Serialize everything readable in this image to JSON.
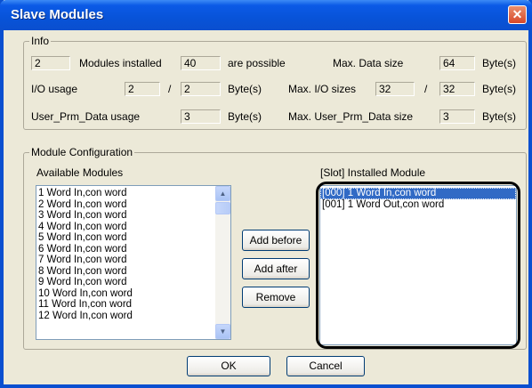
{
  "window": {
    "title": "Slave Modules",
    "close_glyph": "✕"
  },
  "info": {
    "legend": "Info",
    "modules_installed_value": "2",
    "modules_installed_label": "Modules installed",
    "modules_possible_value": "40",
    "modules_possible_label": "are possible",
    "max_data_size_label": "Max. Data size",
    "max_data_size_value": "64",
    "max_data_size_unit": "Byte(s)",
    "io_usage_label": "I/O usage",
    "io_usage_in": "2",
    "io_usage_sep": "/",
    "io_usage_out": "2",
    "io_usage_unit": "Byte(s)",
    "max_io_sizes_label": "Max. I/O sizes",
    "max_io_in": "32",
    "max_io_sep": "/",
    "max_io_out": "32",
    "max_io_unit": "Byte(s)",
    "user_prm_label": "User_Prm_Data usage",
    "user_prm_value": "3",
    "user_prm_unit": "Byte(s)",
    "max_user_prm_label": "Max. User_Prm_Data size",
    "max_user_prm_value": "3",
    "max_user_prm_unit": "Byte(s)"
  },
  "module_config": {
    "legend": "Module Configuration",
    "available_label": "Available Modules",
    "installed_label": "[Slot] Installed Module",
    "available_modules": [
      "1 Word In,con word",
      "2 Word In,con word",
      "3 Word In,con word",
      "4 Word In,con word",
      "5 Word In,con word",
      "6 Word In,con word",
      "7 Word In,con word",
      "8 Word In,con word",
      "9 Word In,con word",
      "10 Word In,con word",
      "11 Word In,con word",
      "12 Word In,con word"
    ],
    "installed_modules": [
      "[000] 1 Word In,con word",
      "[001] 1 Word Out,con word"
    ],
    "selected_installed_index": 0,
    "add_before": "Add before",
    "add_after": "Add after",
    "remove": "Remove"
  },
  "footer": {
    "ok": "OK",
    "cancel": "Cancel"
  },
  "colors": {
    "titlebar": "#0a4fd0",
    "dialog": "#ece9d8",
    "selection": "#316ac5",
    "close": "#d8482a"
  },
  "icons": {
    "close": "close-icon",
    "scroll_up": "chevron-up-icon",
    "scroll_down": "chevron-down-icon"
  }
}
